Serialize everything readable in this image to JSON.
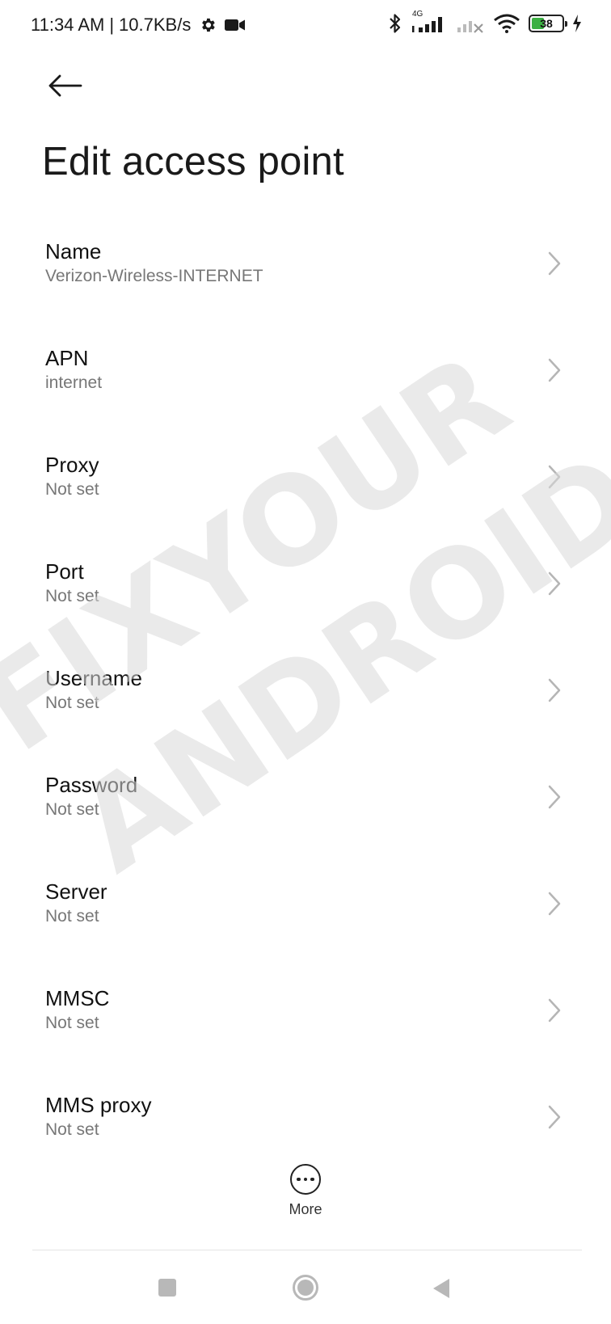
{
  "status_bar": {
    "time": "11:34 AM",
    "separator": "|",
    "net_speed": "10.7KB/s",
    "network_type": "4G",
    "battery_level": "38",
    "icons": [
      "settings-gear-icon",
      "video-camera-icon",
      "bluetooth-icon",
      "signal-4g-icon",
      "signal-no-service-icon",
      "wifi-icon",
      "battery-icon",
      "charging-icon"
    ]
  },
  "header": {
    "back_icon": "arrow-left-icon",
    "title": "Edit access point"
  },
  "settings": [
    {
      "label": "Name",
      "value": "Verizon-Wireless-INTERNET"
    },
    {
      "label": "APN",
      "value": "internet"
    },
    {
      "label": "Proxy",
      "value": "Not set"
    },
    {
      "label": "Port",
      "value": "Not set"
    },
    {
      "label": "Username",
      "value": "Not set"
    },
    {
      "label": "Password",
      "value": "Not set"
    },
    {
      "label": "Server",
      "value": "Not set"
    },
    {
      "label": "MMSC",
      "value": "Not set"
    },
    {
      "label": "MMS proxy",
      "value": "Not set"
    }
  ],
  "more_button": {
    "label": "More",
    "icon": "more-dots-icon"
  },
  "watermark": {
    "line1": "FIXYOUR",
    "line2": "ANDROID"
  },
  "navigation": {
    "icons": [
      "recents-square-icon",
      "home-circle-icon",
      "back-triangle-icon"
    ]
  },
  "colors": {
    "accent_battery": "#3cb043",
    "secondary_text": "#777777",
    "watermark": "#d9d9d9"
  }
}
